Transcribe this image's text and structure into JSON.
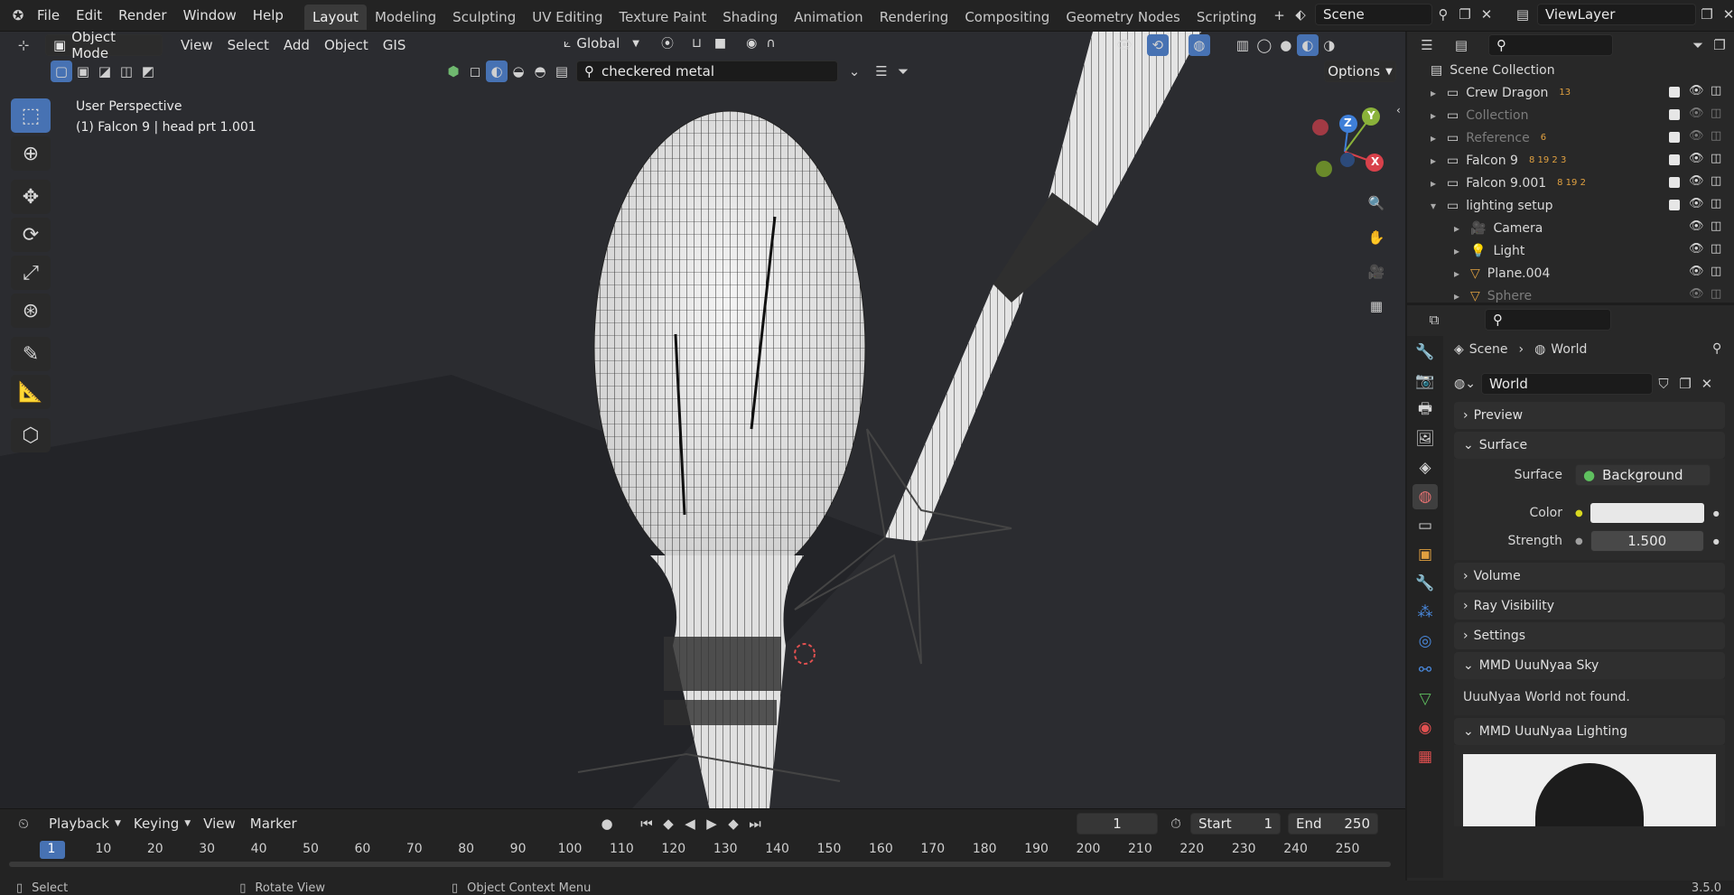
{
  "menu": [
    "File",
    "Edit",
    "Render",
    "Window",
    "Help"
  ],
  "workspaces": [
    "Layout",
    "Modeling",
    "Sculpting",
    "UV Editing",
    "Texture Paint",
    "Shading",
    "Animation",
    "Rendering",
    "Compositing",
    "Geometry Nodes",
    "Scripting"
  ],
  "active_workspace": "Layout",
  "scene_name": "Scene",
  "view_layer": "ViewLayer",
  "viewport": {
    "mode": "Object Mode",
    "menus": [
      "View",
      "Select",
      "Add",
      "Object",
      "GIS"
    ],
    "transform_orientation": "Global",
    "search_text": "checkered metal",
    "options_label": "Options",
    "perspective_label": "User Perspective",
    "object_label": "(1) Falcon 9 | head prt 1.001",
    "gizmo": {
      "x": "X",
      "y": "Y",
      "z": "Z"
    }
  },
  "outliner": {
    "root": "Scene Collection",
    "items": [
      {
        "label": "Crew Dragon",
        "badge": "13",
        "dim": false,
        "indent": 0
      },
      {
        "label": "Collection",
        "badge": "",
        "dim": true,
        "indent": 0
      },
      {
        "label": "Reference",
        "badge": "6",
        "dim": true,
        "indent": 0
      },
      {
        "label": "Falcon 9",
        "badge": "8  19  2  3",
        "dim": false,
        "indent": 0
      },
      {
        "label": "Falcon 9.001",
        "badge": "8  19  2",
        "dim": false,
        "indent": 0
      },
      {
        "label": "lighting setup",
        "badge": "",
        "dim": false,
        "indent": 0
      },
      {
        "label": "Camera",
        "badge": "",
        "dim": false,
        "indent": 1
      },
      {
        "label": "Light",
        "badge": "",
        "dim": false,
        "indent": 1
      },
      {
        "label": "Plane.004",
        "badge": "",
        "dim": false,
        "indent": 1
      },
      {
        "label": "Sphere",
        "badge": "",
        "dim": true,
        "indent": 1
      }
    ]
  },
  "properties": {
    "breadcrumb_scene": "Scene",
    "breadcrumb_world": "World",
    "world_name": "World",
    "panels": {
      "preview": "Preview",
      "surface": "Surface",
      "surface_label": "Surface",
      "surface_value": "Background",
      "color_label": "Color",
      "color_value": "#e8e8e8",
      "strength_label": "Strength",
      "strength_value": "1.500",
      "volume": "Volume",
      "ray_visibility": "Ray Visibility",
      "settings": "Settings",
      "mmd_sky": "MMD UuuNyaa Sky",
      "mmd_sky_msg": "UuuNyaa World not found.",
      "mmd_lighting": "MMD UuuNyaa Lighting"
    }
  },
  "timeline": {
    "menus": [
      "Playback",
      "Keying",
      "View",
      "Marker"
    ],
    "current_frame": "1",
    "start_label": "Start",
    "start": "1",
    "end_label": "End",
    "end": "250",
    "ruler": [
      "1",
      "10",
      "20",
      "30",
      "40",
      "50",
      "60",
      "70",
      "80",
      "90",
      "100",
      "110",
      "120",
      "130",
      "140",
      "150",
      "160",
      "170",
      "180",
      "190",
      "200",
      "210",
      "220",
      "230",
      "240",
      "250"
    ]
  },
  "status": {
    "select": "Select",
    "rotate": "Rotate View",
    "context": "Object Context Menu",
    "version": "3.5.0"
  }
}
